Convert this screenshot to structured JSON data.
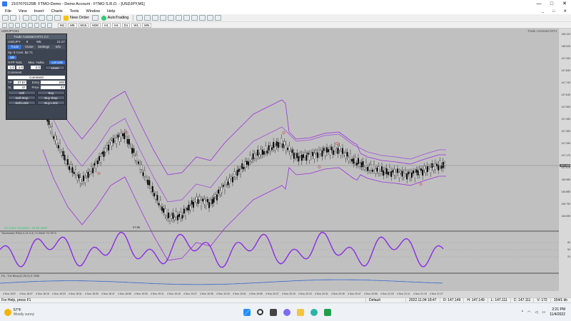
{
  "window": {
    "title": "2107070125B: FTMO-Demo - Demo Account - FTMO S.R.O. - [USDJPY,M1]",
    "controls": [
      "—",
      "□",
      "✕"
    ]
  },
  "menu": {
    "items": [
      "File",
      "View",
      "Insert",
      "Charts",
      "Tools",
      "Window",
      "Help"
    ],
    "right_controls": [
      "_",
      "□",
      "✕"
    ]
  },
  "toolbar": {
    "new_order_label": "New Order",
    "autotrading_label": "AutoTrading",
    "timeframes": [
      "M1",
      "M5",
      "M15",
      "M30",
      "H1",
      "H4",
      "D1",
      "W1",
      "MN"
    ]
  },
  "chart": {
    "title": "USDJPY,M1",
    "ta_label": "Trade Assistant MT4",
    "price_labels": [
      "148.120",
      "148.025",
      "147.930",
      "147.835",
      "147.740",
      "147.645",
      "147.550",
      "147.455",
      "147.360",
      "147.265",
      "147.170",
      "147.075",
      "146.980",
      "146.885",
      "146.790",
      "146.695"
    ],
    "current_price": "147.149",
    "candle_time_label": "27:30",
    "marker_label": "16:26",
    "status_text": "No more minutes - 18:26 sale!",
    "osc_title": "Stochastic RSI(14,14,3,3) 71.5842 75.7873",
    "osc_levels": [
      "80",
      "50",
      "20"
    ],
    "macd_title": "FA - Trix Blue(12,26,9) 0.7856",
    "time_labels": [
      "4 Nov 2022",
      "4 Nov 18:07",
      "4 Nov 18:15",
      "4 Nov 18:23",
      "4 Nov 18:31",
      "4 Nov 18:39",
      "4 Nov 18:47",
      "4 Nov 18:55",
      "4 Nov 19:03",
      "4 Nov 19:11",
      "4 Nov 19:19",
      "4 Nov 19:27",
      "4 Nov 19:35",
      "4 Nov 19:43",
      "4 Nov 19:51",
      "4 Nov 19:59",
      "4 Nov 20:07",
      "4 Nov 20:15",
      "4 Nov 20:23",
      "4 Nov 20:31",
      "4 Nov 20:39",
      "4 Nov 20:47",
      "4 Nov 20:55",
      "4 Nov 21:03",
      "4 Nov 21:11",
      "4 Nov 21:19",
      "4 Nov 21:27"
    ]
  },
  "trade_panel": {
    "title": "Trade Assistant MT4 2.0",
    "symbol": "USDJPY",
    "spread": "8",
    "bid_ask": "M5",
    "time": "21:27",
    "tabs": [
      "Trade",
      "Close",
      "Settings",
      "Info"
    ],
    "sp_label": "Sp: 8  Com: $2.71",
    "lot_label": "SB",
    "risk_label": "%TP  %SL",
    "max_label": "Max. %dsa",
    "lot_value": "1.0",
    "sl_value": "1.0",
    "lot2_value": "2.0",
    "lines_btn": "Lines",
    "lot_calc_btn": "Lot calc",
    "comment_label": "Comment",
    "comment_value": "Comment",
    "tp_label": "TP",
    "tp_value": "27.57",
    "entry_label": "Entry",
    "entry_value": "200",
    "sl_label": "SL",
    "sl_field": "47",
    "price_label": "Price",
    "price_value": "47",
    "sell_btn": "Sell",
    "buy_btn": "Buy",
    "sell_stop_btn": "Sell Stop",
    "buy_stop_btn": "Buy Stop",
    "sell_limit_btn": "Sell Limit",
    "buy_limit_btn": "Buy Limit"
  },
  "statusbar": {
    "help": "For Help, press F1",
    "profile": "Default",
    "datetime": "2022.11.04 18:47",
    "open": "O: 147.149",
    "high": "H: 147.149",
    "low": "L: 147.111",
    "close": "C: 147.111",
    "volume": "V: 172",
    "traffic": "154/1 kb"
  },
  "taskbar": {
    "weather_temp": "57°F",
    "weather_desc": "Mostly sunny",
    "time": "2:21 PM",
    "date": "11/4/2022"
  },
  "colors": {
    "chart_bg": "#c0c0c0",
    "envelope": "#9b30d9",
    "osc_line": "#8a2be2",
    "macd_line": "#3366cc",
    "accent": "#3875d7"
  }
}
